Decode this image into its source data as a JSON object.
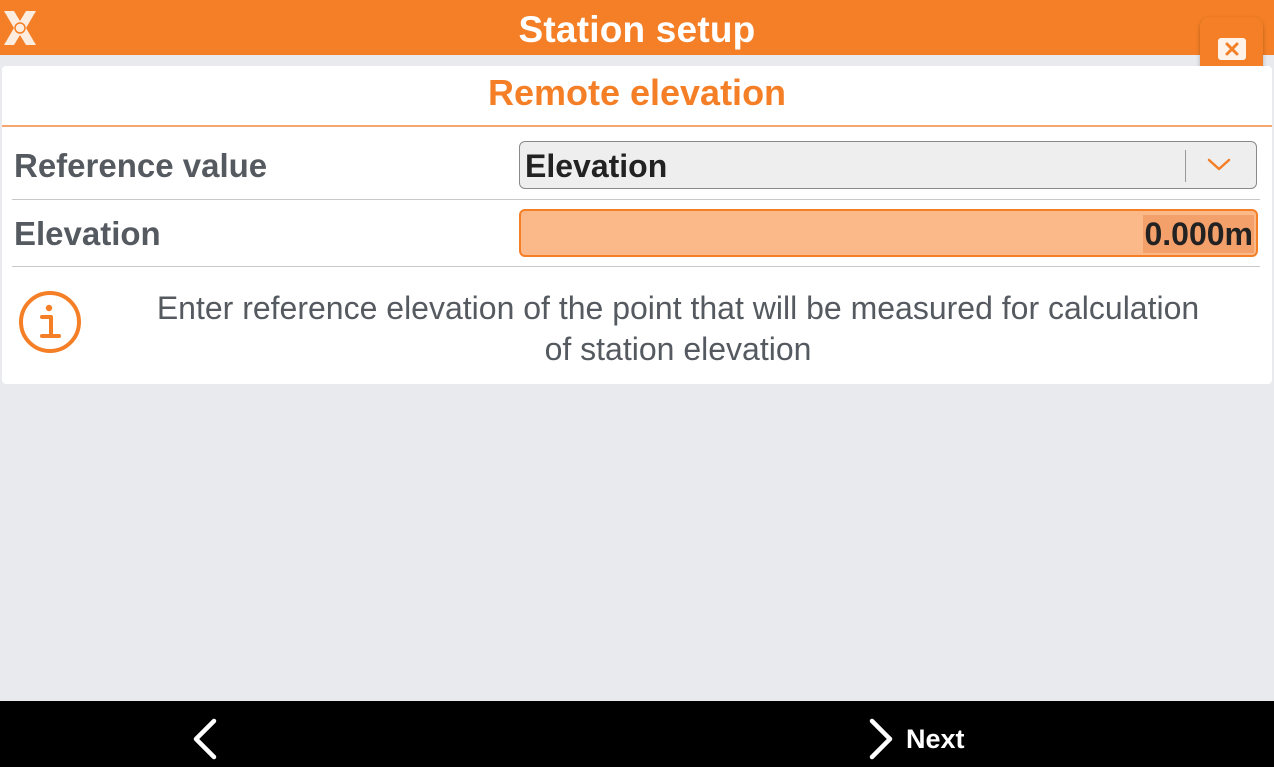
{
  "header": {
    "title": "Station setup",
    "logo_icon": "app-logo-icon",
    "close_icon": "close-icon"
  },
  "card": {
    "title": "Remote elevation",
    "reference_value": {
      "label": "Reference value",
      "selected": "Elevation",
      "dropdown_icon": "chevron-down-icon"
    },
    "elevation": {
      "label": "Elevation",
      "value": "0.000m"
    },
    "info": {
      "icon": "info-icon",
      "text_line1": "Enter reference elevation of the point that will be measured for calculation",
      "text_line2": "of station elevation"
    }
  },
  "navigation": {
    "back_icon": "chevron-left-icon",
    "next_label": "Next",
    "next_icon": "chevron-right-icon"
  },
  "colors": {
    "accent": "#f47f26",
    "input_fill": "#fbb98a",
    "text": "#555a60",
    "background": "#e8eaee"
  }
}
